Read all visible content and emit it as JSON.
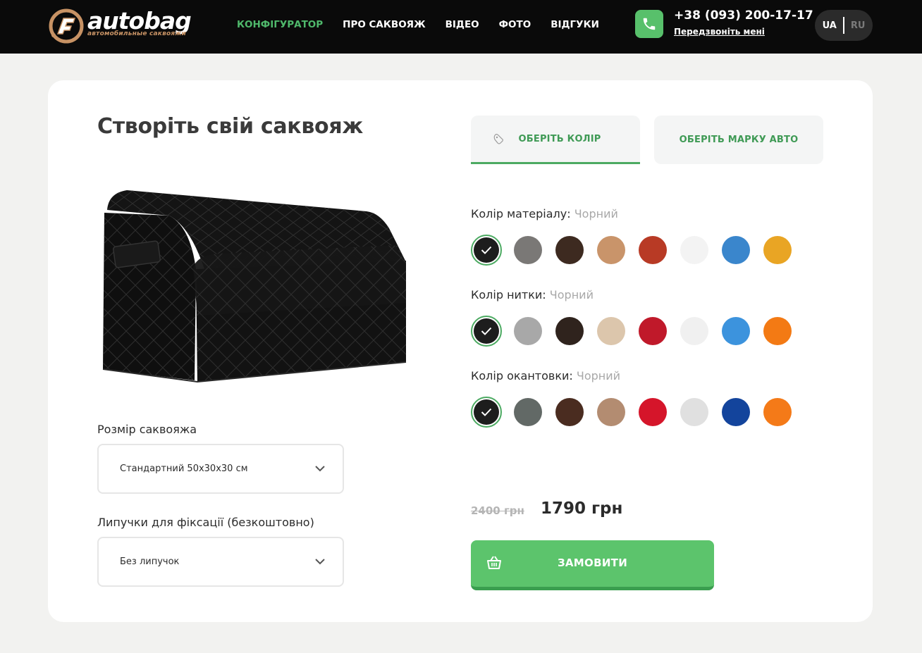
{
  "header": {
    "logo_text": "autobag",
    "logo_subtitle": "автомобильные саквояжи",
    "nav": [
      {
        "label": "Конфігуратор",
        "active": true
      },
      {
        "label": "Про саквояж",
        "active": false
      },
      {
        "label": "Відео",
        "active": false
      },
      {
        "label": "Фото",
        "active": false
      },
      {
        "label": "Відгуки",
        "active": false
      }
    ],
    "phone": "+38 (093) 200-17-17",
    "callback": "Передзвоніть мені",
    "lang_active": "UA",
    "lang_other": "RU"
  },
  "configurator": {
    "title": "Створіть свій саквояж",
    "size_label": "Розмір саквояжа",
    "size_value": "Стандартний 50х30х30 см",
    "velcro_label": "Липучки для фіксації (безкоштовно)",
    "velcro_value": "Без липучок"
  },
  "tabs": [
    {
      "label": "Оберіть колір",
      "active": true
    },
    {
      "label": "Оберіть марку авто",
      "active": false
    }
  ],
  "color_groups": [
    {
      "label": "Колір матеріалу:",
      "selected": "Чорний",
      "swatches": [
        "#1d1d1d",
        "#7a7876",
        "#3d2a20",
        "#c9946a",
        "#b83a25",
        "#f3f3f3",
        "#3a86cc",
        "#e9a524"
      ]
    },
    {
      "label": "Колір нитки:",
      "selected": "Чорний",
      "swatches": [
        "#1d1d1d",
        "#a8a8a8",
        "#2f231d",
        "#dcc6ac",
        "#c0192a",
        "#f0f0f0",
        "#3c93dd",
        "#f37a14"
      ]
    },
    {
      "label": "Колір окантовки:",
      "selected": "Чорний",
      "swatches": [
        "#1d1d1d",
        "#626966",
        "#4a2c20",
        "#b38c71",
        "#d5152a",
        "#e0e0e0",
        "#13449c",
        "#f47a18"
      ]
    }
  ],
  "pricing": {
    "old_price": "2400 грн",
    "price": "1790 грн"
  },
  "order_button": "Замовити",
  "colors": {
    "accent_green": "#4fb86b",
    "button_green": "#5cc46c",
    "header_bg": "#0a0a0a",
    "page_bg": "#f2f2f0"
  }
}
